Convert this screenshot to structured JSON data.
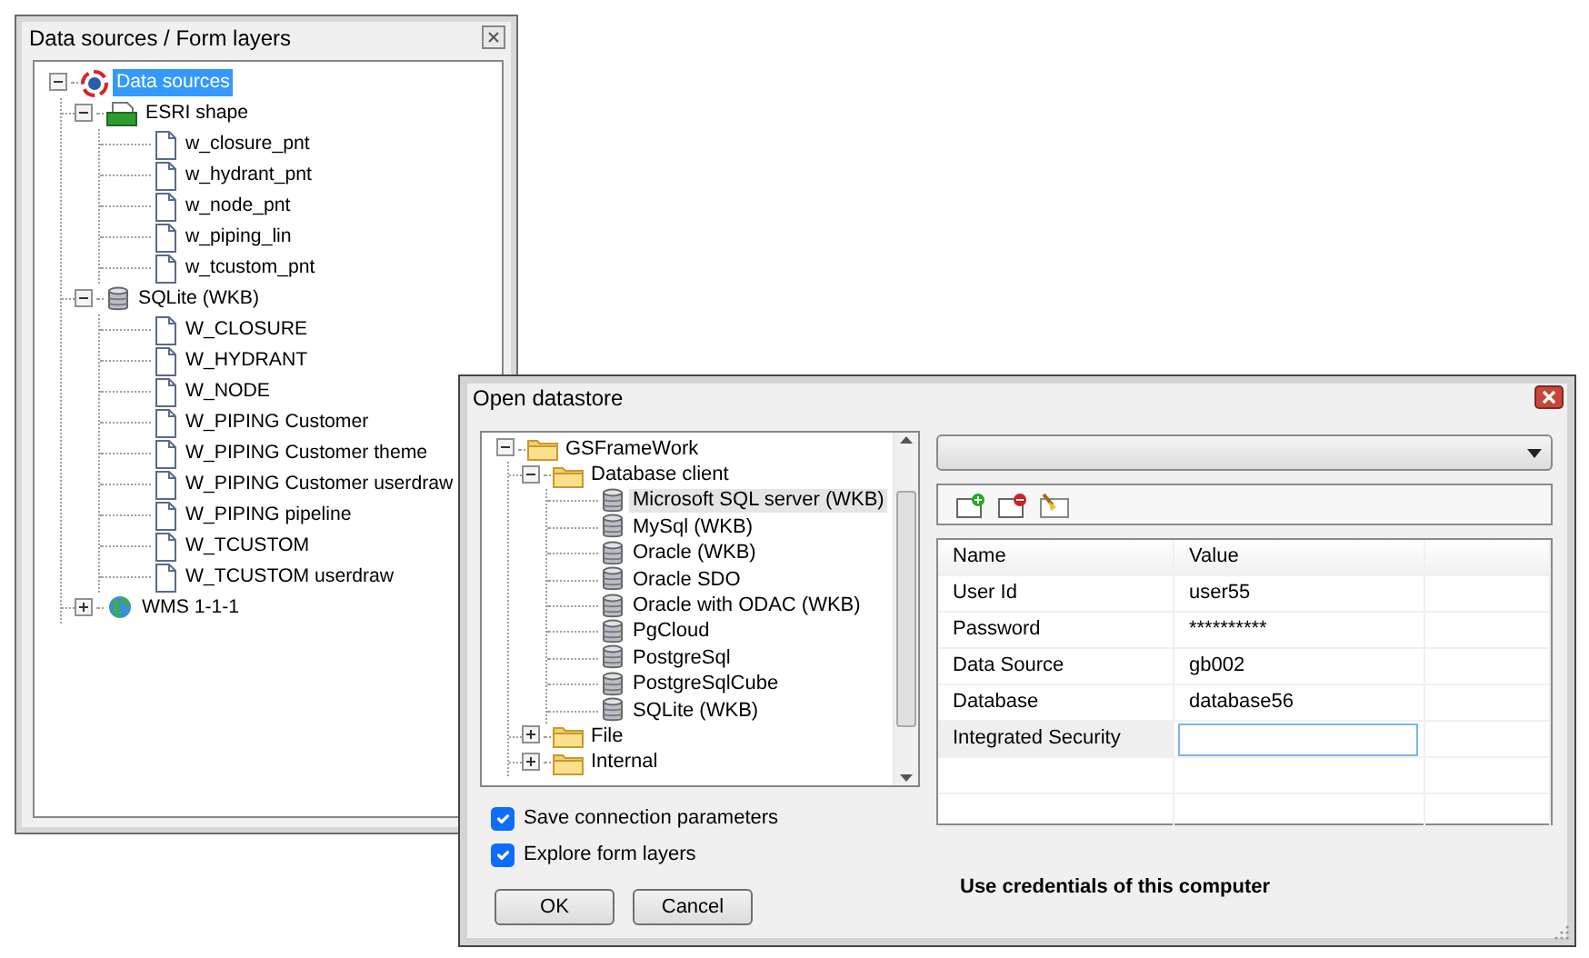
{
  "layers_panel": {
    "title": "Data sources / Form layers",
    "tree": [
      {
        "label": "Data sources",
        "kind": "root",
        "expanded": true,
        "selected": true,
        "children": [
          {
            "label": "ESRI shape",
            "kind": "shape",
            "expanded": true,
            "selected": false,
            "children": [
              {
                "label": "w_closure_pnt",
                "kind": "file",
                "selected": false
              },
              {
                "label": "w_hydrant_pnt",
                "kind": "file",
                "selected": false
              },
              {
                "label": "w_node_pnt",
                "kind": "file",
                "selected": false
              },
              {
                "label": "w_piping_lin",
                "kind": "file",
                "selected": false
              },
              {
                "label": "w_tcustom_pnt",
                "kind": "file",
                "selected": false
              }
            ]
          },
          {
            "label": "SQLite (WKB)",
            "kind": "database",
            "expanded": true,
            "selected": false,
            "children": [
              {
                "label": "W_CLOSURE",
                "kind": "file",
                "selected": false
              },
              {
                "label": "W_HYDRANT",
                "kind": "file",
                "selected": false
              },
              {
                "label": "W_NODE",
                "kind": "file",
                "selected": false
              },
              {
                "label": "W_PIPING Customer",
                "kind": "file",
                "selected": false
              },
              {
                "label": "W_PIPING Customer theme",
                "kind": "file",
                "selected": false
              },
              {
                "label": "W_PIPING Customer userdraw",
                "kind": "file",
                "selected": false
              },
              {
                "label": "W_PIPING pipeline",
                "kind": "file",
                "selected": false
              },
              {
                "label": "W_TCUSTOM",
                "kind": "file",
                "selected": false
              },
              {
                "label": "W_TCUSTOM userdraw",
                "kind": "file",
                "selected": false
              }
            ]
          },
          {
            "label": "WMS 1-1-1",
            "kind": "globe",
            "expanded": false,
            "selected": false
          }
        ]
      }
    ]
  },
  "dialog": {
    "title": "Open datastore",
    "tree": [
      {
        "label": "GSFrameWork",
        "kind": "folder",
        "expanded": true,
        "selected": false,
        "children": [
          {
            "label": "Database client",
            "kind": "folder",
            "expanded": true,
            "selected": false,
            "children": [
              {
                "label": "Microsoft SQL server (WKB)",
                "kind": "database",
                "selected": true
              },
              {
                "label": "MySql (WKB)",
                "kind": "database",
                "selected": false
              },
              {
                "label": "Oracle (WKB)",
                "kind": "database",
                "selected": false
              },
              {
                "label": "Oracle SDO",
                "kind": "database",
                "selected": false
              },
              {
                "label": "Oracle with ODAC (WKB)",
                "kind": "database",
                "selected": false
              },
              {
                "label": "PgCloud",
                "kind": "database",
                "selected": false
              },
              {
                "label": "PostgreSql",
                "kind": "database",
                "selected": false
              },
              {
                "label": "PostgreSqlCube",
                "kind": "database",
                "selected": false
              },
              {
                "label": "SQLite (WKB)",
                "kind": "database",
                "selected": false
              }
            ]
          },
          {
            "label": "File",
            "kind": "folder",
            "expanded": false,
            "selected": false
          },
          {
            "label": "Internal",
            "kind": "folder",
            "expanded": false,
            "selected": false
          }
        ]
      }
    ],
    "checkboxes": [
      {
        "label": "Save connection parameters",
        "checked": true
      },
      {
        "label": "Explore form layers",
        "checked": true
      }
    ],
    "buttons": [
      "OK",
      "Cancel"
    ],
    "grid": {
      "columns": [
        "Name",
        "Value"
      ],
      "rows": [
        {
          "name": "User Id",
          "value": "user55",
          "editing": false
        },
        {
          "name": "Password",
          "value": "**********",
          "editing": false
        },
        {
          "name": "Data Source",
          "value": "gb002",
          "editing": false
        },
        {
          "name": "Database",
          "value": "database56",
          "editing": false
        },
        {
          "name": "Integrated Security",
          "value": "",
          "editing": true
        }
      ]
    },
    "description": "Use credentials of this computer"
  }
}
